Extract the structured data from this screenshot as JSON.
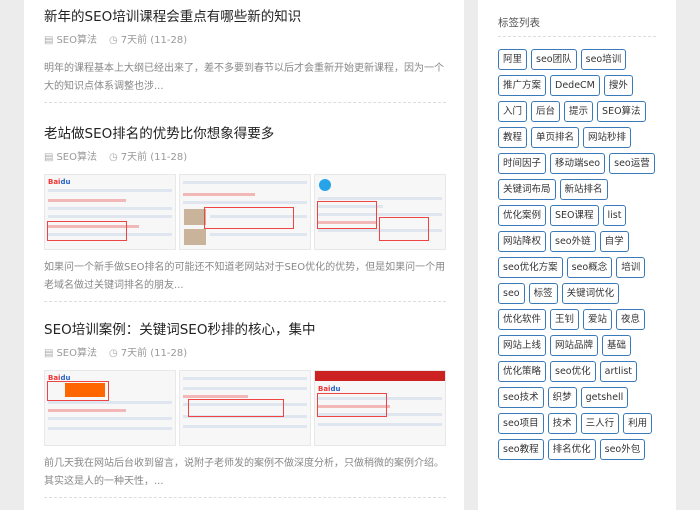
{
  "posts": [
    {
      "title": "新年的SEO培训课程会重点有哪些新的知识",
      "category": "SEO算法",
      "time": "7天前 (11-28)",
      "excerpt": "明年的课程基本上大纲已经出来了，差不多要到春节以后才会重新开始更新课程，因为一个大的知识点体系调整也涉..."
    },
    {
      "title": "老站做SEO排名的优势比你想象得要多",
      "category": "SEO算法",
      "time": "7天前 (11-28)",
      "excerpt": "如果问一个新手做SEO排名的可能还不知道老网站对于SEO优化的优势，但是如果问一个用老域名做过关键词排名的朋友..."
    },
    {
      "title": "SEO培训案例：关键词SEO秒排的核心，集中",
      "category": "SEO算法",
      "time": "7天前 (11-28)",
      "excerpt": "前几天我在网站后台收到留言，说附子老师发的案例不做深度分析，只做稍微的案例介绍。其实这是人的一种天性，..."
    }
  ],
  "icons": {
    "category": "folder-icon",
    "time": "clock-icon"
  },
  "sidebar": {
    "title": "标签列表",
    "tags": [
      "阿里",
      "seo团队",
      "seo培训",
      "推广方案",
      "DedeCM",
      "搜外",
      "入门",
      "后台",
      "提示",
      "SEO算法",
      "教程",
      "单页排名",
      "网站秒排",
      "时间因子",
      "移动端seo",
      "seo运营",
      "关键词布局",
      "新站排名",
      "优化案例",
      "SEO课程",
      "list",
      "网站降权",
      "seo外链",
      "自学",
      "seo优化方案",
      "seo概念",
      "培训",
      "seo",
      "标签",
      "关键词优化",
      "优化软件",
      "王钊",
      "爱站",
      "夜息",
      "网站上线",
      "网站品牌",
      "基础",
      "优化策略",
      "seo优化",
      "artlist",
      "seo技术",
      "织梦",
      "getshell",
      "seo项目",
      "技术",
      "三人行",
      "利用",
      "seo教程",
      "排名优化",
      "seo外包"
    ]
  },
  "colors": {
    "tag_border": "#3a7ab8",
    "background": "#ececec"
  }
}
